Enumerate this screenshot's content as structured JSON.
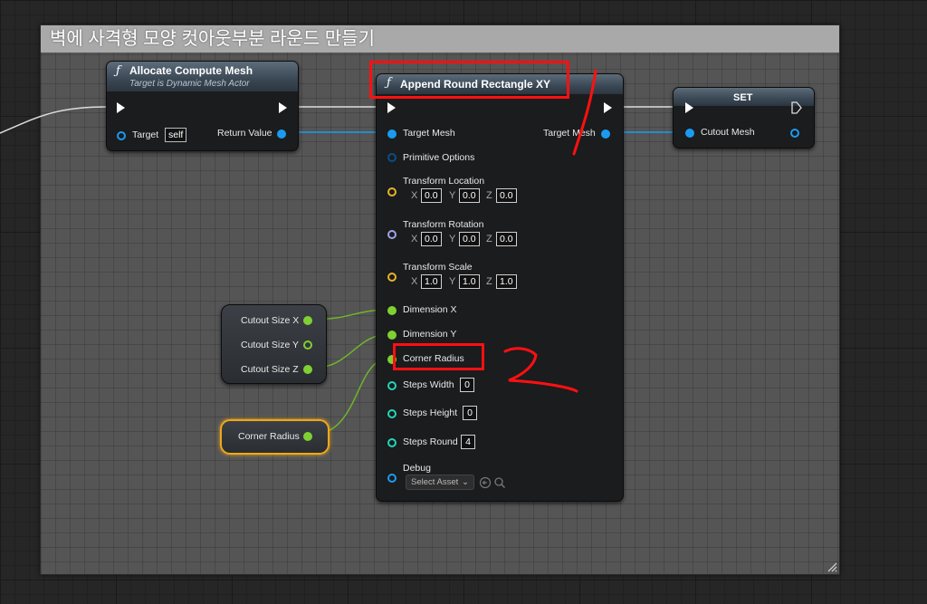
{
  "comment": {
    "title": "벽에 사격형 모양 컷아웃부분 라운드 만들기"
  },
  "allocate_node": {
    "title": "Allocate Compute Mesh",
    "subtitle": "Target is Dynamic Mesh Actor",
    "target_label": "Target",
    "target_value": "self",
    "return_label": "Return Value"
  },
  "append_node": {
    "title": "Append Round Rectangle XY",
    "target_mesh_in": "Target Mesh",
    "target_mesh_out": "Target Mesh",
    "primitive_options": "Primitive Options",
    "transform_location": {
      "label": "Transform Location",
      "x": "0.0",
      "y": "0.0",
      "z": "0.0"
    },
    "transform_rotation": {
      "label": "Transform Rotation",
      "x": "0.0",
      "y": "0.0",
      "z": "0.0"
    },
    "transform_scale": {
      "label": "Transform Scale",
      "x": "1.0",
      "y": "1.0",
      "z": "1.0"
    },
    "axis_x": "X",
    "axis_y": "Y",
    "axis_z": "Z",
    "dimension_x": "Dimension X",
    "dimension_y": "Dimension Y",
    "corner_radius": "Corner Radius",
    "steps_width": {
      "label": "Steps Width",
      "value": "0"
    },
    "steps_height": {
      "label": "Steps Height",
      "value": "0"
    },
    "steps_round": {
      "label": "Steps Round",
      "value": "4"
    },
    "debug": {
      "label": "Debug",
      "select": "Select Asset"
    }
  },
  "set_node": {
    "title": "SET",
    "cutout_mesh": "Cutout Mesh"
  },
  "cutout_size_node": {
    "x": "Cutout Size X",
    "y": "Cutout Size Y",
    "z": "Cutout Size Z"
  },
  "corner_radius_var": {
    "label": "Corner Radius"
  },
  "colors": {
    "object_pin": "#1b9bf0",
    "float_pin": "#7fd032",
    "vector_pin": "#e8b22b",
    "rotator_pin": "#9ea3e8",
    "int_pin": "#22d6b8",
    "annotation_red": "#ff1010",
    "exec_wire": "#ffffff"
  },
  "icons": {
    "function": "function-icon",
    "exec": "exec-pin-icon",
    "resize": "resize-grip-icon",
    "browse": "browse-arrow-icon",
    "search": "search-icon",
    "dropdown": "chevron-down-icon"
  },
  "annotations": {
    "handwritten_mark": "ㄱ / 2"
  }
}
